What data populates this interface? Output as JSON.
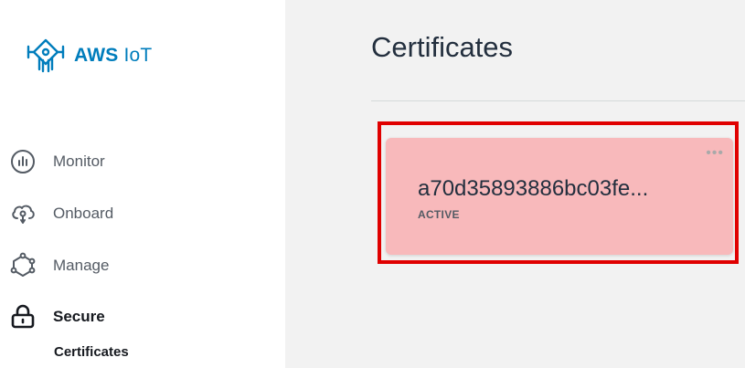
{
  "brand": {
    "name_bold": "AWS",
    "name_rest": "IoT",
    "logo_icon": "aws-iot-logo-icon",
    "color": "#007dbc"
  },
  "sidebar": {
    "items": [
      {
        "label": "Monitor",
        "icon": "monitor-icon"
      },
      {
        "label": "Onboard",
        "icon": "onboard-icon"
      },
      {
        "label": "Manage",
        "icon": "manage-icon"
      },
      {
        "label": "Secure",
        "icon": "lock-icon",
        "active": true
      }
    ],
    "subitems": [
      {
        "label": "Certificates",
        "active": true
      }
    ]
  },
  "main": {
    "title": "Certificates",
    "cards": [
      {
        "id": "a70d35893886bc03fe...",
        "status": "ACTIVE",
        "menu": "•••"
      }
    ]
  },
  "colors": {
    "highlight": "#e00000",
    "card_background": "#f8b9bb",
    "page_background": "#f2f2f2"
  }
}
